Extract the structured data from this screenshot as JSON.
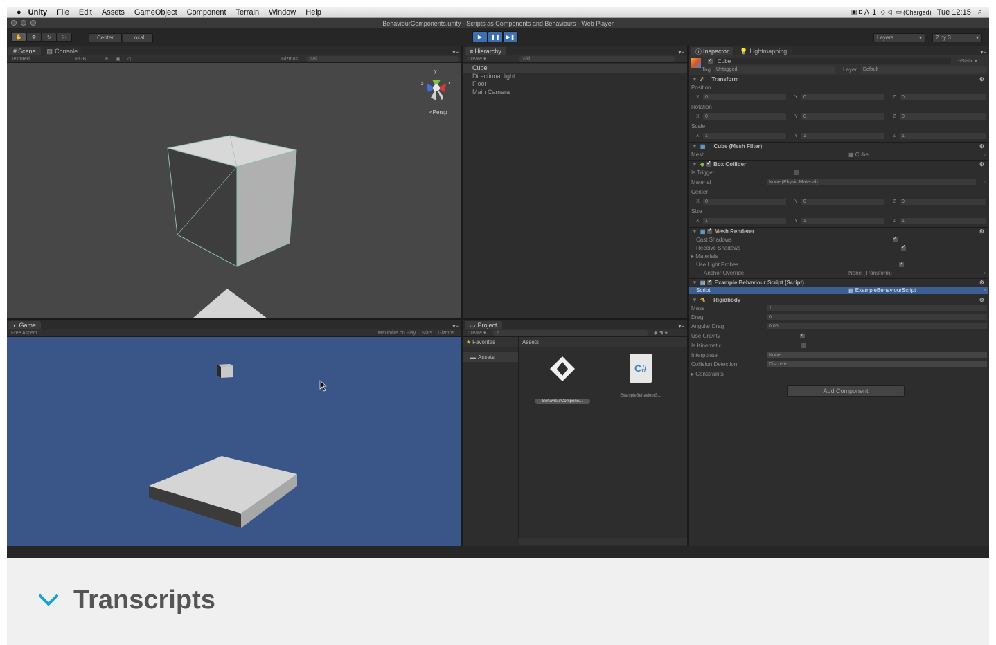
{
  "menubar": {
    "app": "Unity",
    "items": [
      "File",
      "Edit",
      "Assets",
      "GameObject",
      "Component",
      "Terrain",
      "Window",
      "Help"
    ],
    "battery": "(Charged)",
    "clock": "Tue 12:15",
    "extra": "1"
  },
  "window": {
    "title": "BehaviourComponents.unity - Scripts as Components and Behaviours - Web Player"
  },
  "toolbar": {
    "center": "Center",
    "local": "Local",
    "layers": "Layers",
    "layout": "2 by 3"
  },
  "scene": {
    "tab": "Scene",
    "tab2": "Console",
    "shading": "Textured",
    "render_mode": "RGB",
    "gizmos": "Gizmos",
    "search": "All",
    "persp": "Persp",
    "axis_x": "x",
    "axis_y": "y",
    "axis_z": "z"
  },
  "game": {
    "tab": "Game",
    "aspect": "Free Aspect",
    "maximize": "Maximize on Play",
    "stats": "Stats",
    "gizmos": "Gizmos"
  },
  "hierarchy": {
    "tab": "Hierarchy",
    "create": "Create",
    "search": "All",
    "items": [
      "Cube",
      "Directional light",
      "Floor",
      "Main Camera"
    ]
  },
  "project": {
    "tab": "Project",
    "create": "Create",
    "favorites": "Favorites",
    "assets_folder": "Assets",
    "assets_header": "Assets",
    "files": [
      {
        "name": "BehaviourCompone...",
        "icon": "unity-scene-icon"
      },
      {
        "name": "ExampleBehaviourS...",
        "icon": "csharp-script-icon",
        "glyph": "C#"
      }
    ]
  },
  "inspector": {
    "tab": "Inspector",
    "tab2": "Lightmapping",
    "object_name": "Cube",
    "static": "Static",
    "tag_label": "Tag",
    "tag_value": "Untagged",
    "layer_label": "Layer",
    "layer_value": "Default",
    "transform": {
      "title": "Transform",
      "position_label": "Position",
      "rotation_label": "Rotation",
      "scale_label": "Scale",
      "position": [
        "0",
        "0",
        "0"
      ],
      "rotation": [
        "0",
        "0",
        "0"
      ],
      "scale": [
        "1",
        "1",
        "1"
      ]
    },
    "axis_labels": [
      "X",
      "Y",
      "Z"
    ],
    "mesh_filter": {
      "title": "Cube (Mesh Filter)",
      "mesh_label": "Mesh",
      "mesh_value": "Cube"
    },
    "box_collider": {
      "title": "Box Collider",
      "is_trigger": "Is Trigger",
      "material_label": "Material",
      "material_value": "None (Physic Material)",
      "center_label": "Center",
      "size_label": "Size",
      "center": [
        "0",
        "0",
        "0"
      ],
      "size": [
        "1",
        "1",
        "1"
      ]
    },
    "mesh_renderer": {
      "title": "Mesh Renderer",
      "cast_shadows": "Cast Shadows",
      "receive_shadows": "Receive Shadows",
      "materials": "Materials",
      "use_light_probes": "Use Light Probes",
      "anchor_override": "Anchor Override",
      "anchor_value": "None (Transform)"
    },
    "script": {
      "title": "Example Behaviour Script (Script)",
      "label": "Script",
      "value": "ExampleBehaviourScript"
    },
    "rigidbody": {
      "title": "Rigidbody",
      "mass_label": "Mass",
      "mass": "1",
      "drag_label": "Drag",
      "drag": "0",
      "angular_drag_label": "Angular Drag",
      "angular_drag": "0.05",
      "use_gravity": "Use Gravity",
      "is_kinematic": "Is Kinematic",
      "interpolate_label": "Interpolate",
      "interpolate": "None",
      "collision_label": "Collision Detection",
      "collision": "Discrete",
      "constraints": "Constraints"
    },
    "add_component": "Add Component"
  },
  "transcripts": {
    "title": "Transcripts",
    "accent": "#1aa3c9"
  }
}
